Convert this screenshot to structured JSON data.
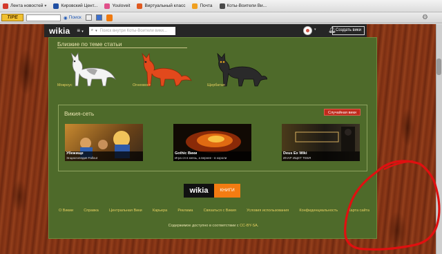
{
  "browser": {
    "bookmarks": [
      {
        "label": "Лента новостей",
        "color": "#d33a2c"
      },
      {
        "label": "Кировский Цент...",
        "color": "#1f4fa3"
      },
      {
        "label": "Youloveit",
        "color": "#e0508a"
      },
      {
        "label": "Виртуальный класс",
        "color": "#e05a20"
      },
      {
        "label": "Почта",
        "color": "#f0a020"
      },
      {
        "label": "Коты-Воители Ви...",
        "color": "#4a4a4a"
      }
    ],
    "toolbar": {
      "logo": "TIPE",
      "search_label": "Поиск"
    }
  },
  "wikia": {
    "logo": "wikia",
    "menu_icon": "≡",
    "search_placeholder": "Поиск внутри Коты-Воители вики...",
    "create_button": "Создать вики"
  },
  "related": {
    "title": "Близкие по теме статьи",
    "items": [
      {
        "label": "Мокроус"
      },
      {
        "label": "Огнехвост"
      },
      {
        "label": "Щербатая"
      }
    ]
  },
  "network": {
    "title": "Викия-сеть",
    "random_button": "Случайная вики",
    "cards": [
      {
        "title": "Убежище",
        "subtitle": "Энциклопедия Fallout"
      },
      {
        "title": "Gothic Вики",
        "subtitle": "Игра ся в князь, а вернее - в короли"
      },
      {
        "title": "Deus Ex Wiki",
        "subtitle": "ИНАР ИЩЕТ ТЕБЯ"
      }
    ]
  },
  "footer": {
    "logo_left": "wikia",
    "logo_right": "КНИГИ",
    "links": [
      "О Викии",
      "Справка",
      "Центральная Вики",
      "Карьера",
      "Реклама",
      "Связаться с Викия",
      "Условия использования",
      "Конфиденциальность",
      "Карта сайта"
    ],
    "license_prefix": "Содержимое доступно в соответствии с",
    "license_link": "CC-BY-SA",
    "license_suffix": "."
  }
}
